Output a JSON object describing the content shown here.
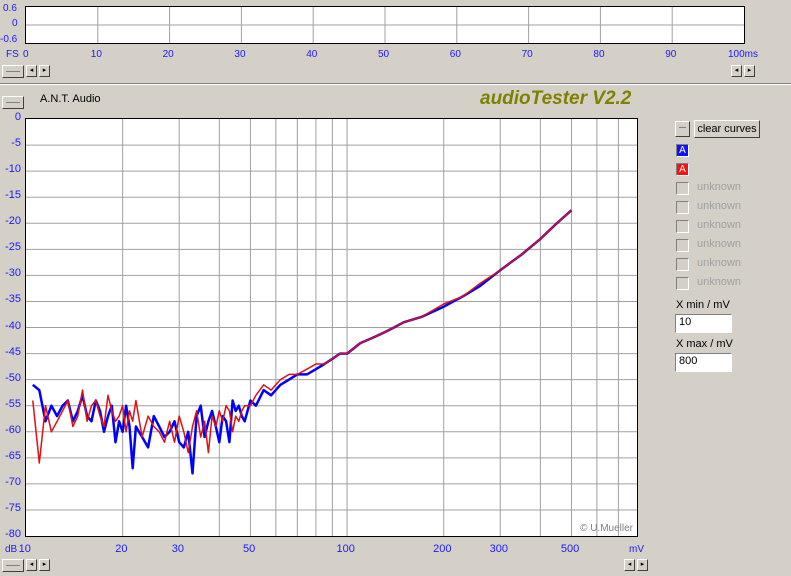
{
  "top_chart": {
    "y_ticks": [
      "0.6",
      "0",
      "-0.6"
    ],
    "fs_label": "FS",
    "x_ticks": [
      "0",
      "10",
      "20",
      "30",
      "40",
      "50",
      "60",
      "70",
      "80",
      "90"
    ],
    "x_last": "100ms"
  },
  "header": {
    "vendor": "A.N.T. Audio",
    "app_title": "audioTester V2.2",
    "title_color": "#808000"
  },
  "side_panel": {
    "clear_curves_label": "clear curves",
    "channel_a_blue": "A",
    "channel_a_red": "A",
    "unknown_labels": [
      "unknown",
      "unknown",
      "unknown",
      "unknown",
      "unknown",
      "unknown"
    ],
    "x_min_label": "X min / mV",
    "x_min_value": "10",
    "x_max_label": "X max / mV",
    "x_max_value": "800"
  },
  "colors": {
    "blue_curve": "#0000ff",
    "red_curve": "#e01010",
    "axis_text": "#1a1aff"
  },
  "chart_data": {
    "type": "line",
    "title": "",
    "xlabel": "mV",
    "ylabel": "dB",
    "x_scale": "log",
    "xlim": [
      10,
      800
    ],
    "ylim": [
      -80,
      0
    ],
    "y_ticks": [
      "0",
      "-5",
      "-10",
      "-15",
      "-20",
      "-25",
      "-30",
      "-35",
      "-40",
      "-45",
      "-50",
      "-55",
      "-60",
      "-65",
      "-70",
      "-75",
      "-80"
    ],
    "y_unit_label": "dB",
    "x_tick_labels": [
      "10",
      "20",
      "30",
      "50",
      "100",
      "200",
      "300",
      "500"
    ],
    "x_unit_label": "mV",
    "grid": true,
    "copyright": "© U.Mueller",
    "series": [
      {
        "color": "#0000ff",
        "x": [
          10.5,
          11,
          11.5,
          12,
          12.5,
          13,
          13.5,
          14,
          14.5,
          15,
          15.5,
          16,
          16.5,
          17,
          17.5,
          18,
          18.5,
          19,
          19.5,
          20,
          20.5,
          21,
          21.5,
          22,
          23,
          24,
          25,
          26,
          27,
          28,
          29,
          30,
          31,
          32,
          33,
          34,
          35,
          36,
          37,
          38,
          39,
          40,
          41,
          42,
          43,
          44,
          45,
          46,
          47,
          48,
          50,
          52,
          55,
          58,
          62,
          66,
          70,
          75,
          80,
          85,
          90,
          95,
          100,
          110,
          120,
          130,
          140,
          150,
          170,
          200,
          230,
          260,
          300,
          350,
          400,
          450,
          500
        ],
        "y": [
          -51,
          -52,
          -58,
          -55,
          -57,
          -55,
          -54,
          -58,
          -56,
          -53,
          -57,
          -58,
          -54,
          -56,
          -60,
          -57,
          -55,
          -62,
          -58,
          -60,
          -55,
          -59,
          -67,
          -59,
          -61,
          -63,
          -57,
          -59,
          -61,
          -60,
          -58,
          -62,
          -63,
          -60,
          -68,
          -57,
          -55,
          -61,
          -58,
          -56,
          -59,
          -62,
          -57,
          -58,
          -62,
          -54,
          -56,
          -55,
          -57,
          -58,
          -54,
          -55,
          -52,
          -53,
          -51,
          -50,
          -49,
          -49,
          -48,
          -47,
          -46,
          -45,
          -45,
          -43,
          -42,
          -41,
          -40,
          -39,
          -38,
          -36,
          -34,
          -32,
          -29,
          -26,
          -23,
          -20,
          -17.5
        ]
      },
      {
        "color": "#e01010",
        "x": [
          10.5,
          11,
          11.5,
          12,
          12.5,
          13,
          13.5,
          14,
          14.5,
          15,
          15.5,
          16,
          16.5,
          17,
          17.5,
          18,
          18.5,
          19,
          19.5,
          20,
          20.5,
          21,
          21.5,
          22,
          23,
          24,
          25,
          26,
          27,
          28,
          29,
          30,
          31,
          32,
          33,
          34,
          35,
          36,
          37,
          38,
          39,
          40,
          41,
          42,
          43,
          44,
          45,
          46,
          47,
          48,
          50,
          52,
          55,
          58,
          62,
          66,
          70,
          75,
          80,
          85,
          90,
          95,
          100,
          110,
          120,
          130,
          140,
          150,
          170,
          200,
          230,
          260,
          300,
          350,
          400,
          450,
          500
        ],
        "y": [
          -54,
          -66,
          -55,
          -60,
          -58,
          -56,
          -54,
          -59,
          -57,
          -52,
          -58,
          -55,
          -54,
          -57,
          -59,
          -53,
          -56,
          -58,
          -57,
          -55,
          -60,
          -56,
          -58,
          -54,
          -61,
          -57,
          -59,
          -60,
          -62,
          -58,
          -62,
          -57,
          -60,
          -64,
          -59,
          -56,
          -61,
          -58,
          -64,
          -57,
          -59,
          -56,
          -58,
          -55,
          -56,
          -60,
          -57,
          -58,
          -56,
          -55,
          -55,
          -53,
          -51,
          -52,
          -50,
          -49,
          -49,
          -48,
          -47,
          -47,
          -46,
          -45,
          -45,
          -43,
          -42,
          -41,
          -40,
          -39,
          -38,
          -35.5,
          -34,
          -31.5,
          -29,
          -26,
          -23,
          -20,
          -17.5
        ]
      }
    ]
  }
}
